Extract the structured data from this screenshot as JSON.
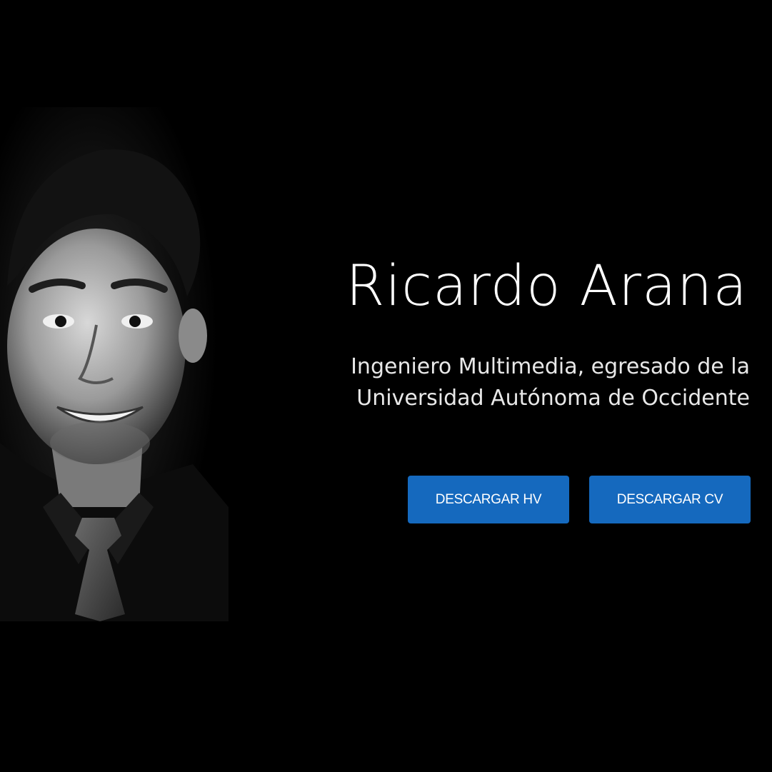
{
  "profile": {
    "name": "Ricardo Arana",
    "subtitle_line1": "Ingeniero Multimedia, egresado de la",
    "subtitle_line2": "Universidad Autónoma de Occidente"
  },
  "actions": {
    "download_hv_label": "DESCARGAR HV",
    "download_cv_label": "DESCARGAR CV"
  },
  "colors": {
    "background": "#000000",
    "button": "#1569be",
    "text": "#ffffff"
  }
}
